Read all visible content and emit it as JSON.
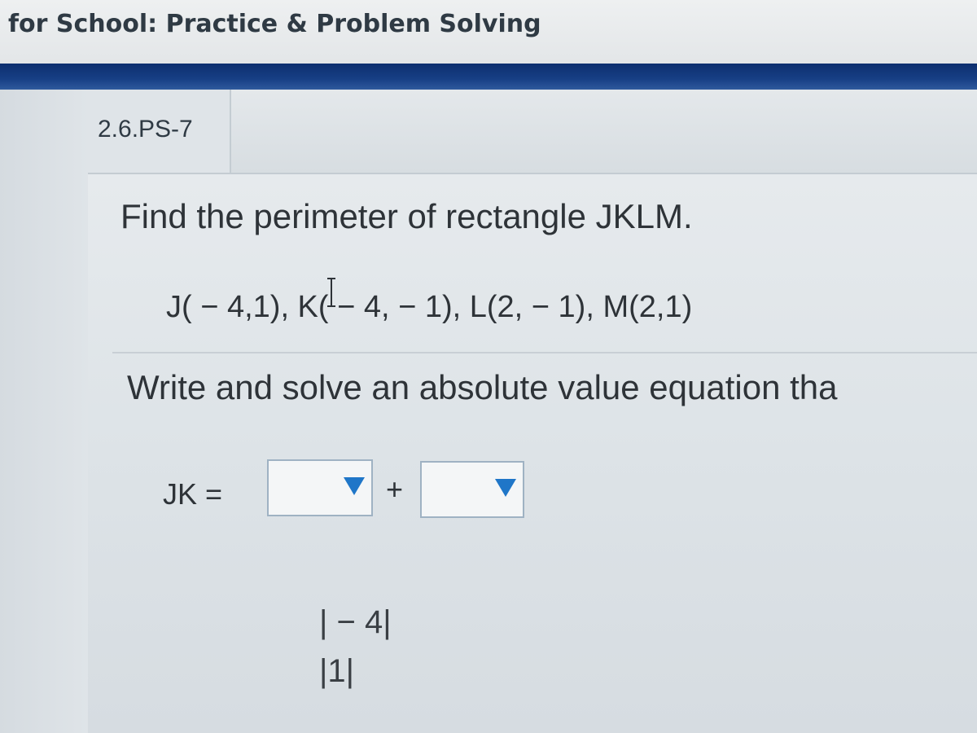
{
  "header": {
    "title": "for School: Practice & Problem Solving"
  },
  "problem": {
    "id": "2.6.PS-7",
    "question": "Find the perimeter of rectangle JKLM.",
    "points": "J( − 4,1), K( − 4, − 1), L(2, − 1), M(2,1)",
    "instruction": "Write and solve an absolute value equation tha"
  },
  "equation": {
    "label": "JK =",
    "operator": "+",
    "dropdown1_value": "",
    "dropdown2_value": "",
    "options": [
      "| − 4|",
      "|1|"
    ]
  },
  "colors": {
    "blue_bar": "#173f85",
    "dropdown_arrow": "#1f76c8"
  },
  "icons": {
    "text_cursor": "i-beam-cursor-icon",
    "dropdown_arrow": "triangle-down-icon"
  }
}
